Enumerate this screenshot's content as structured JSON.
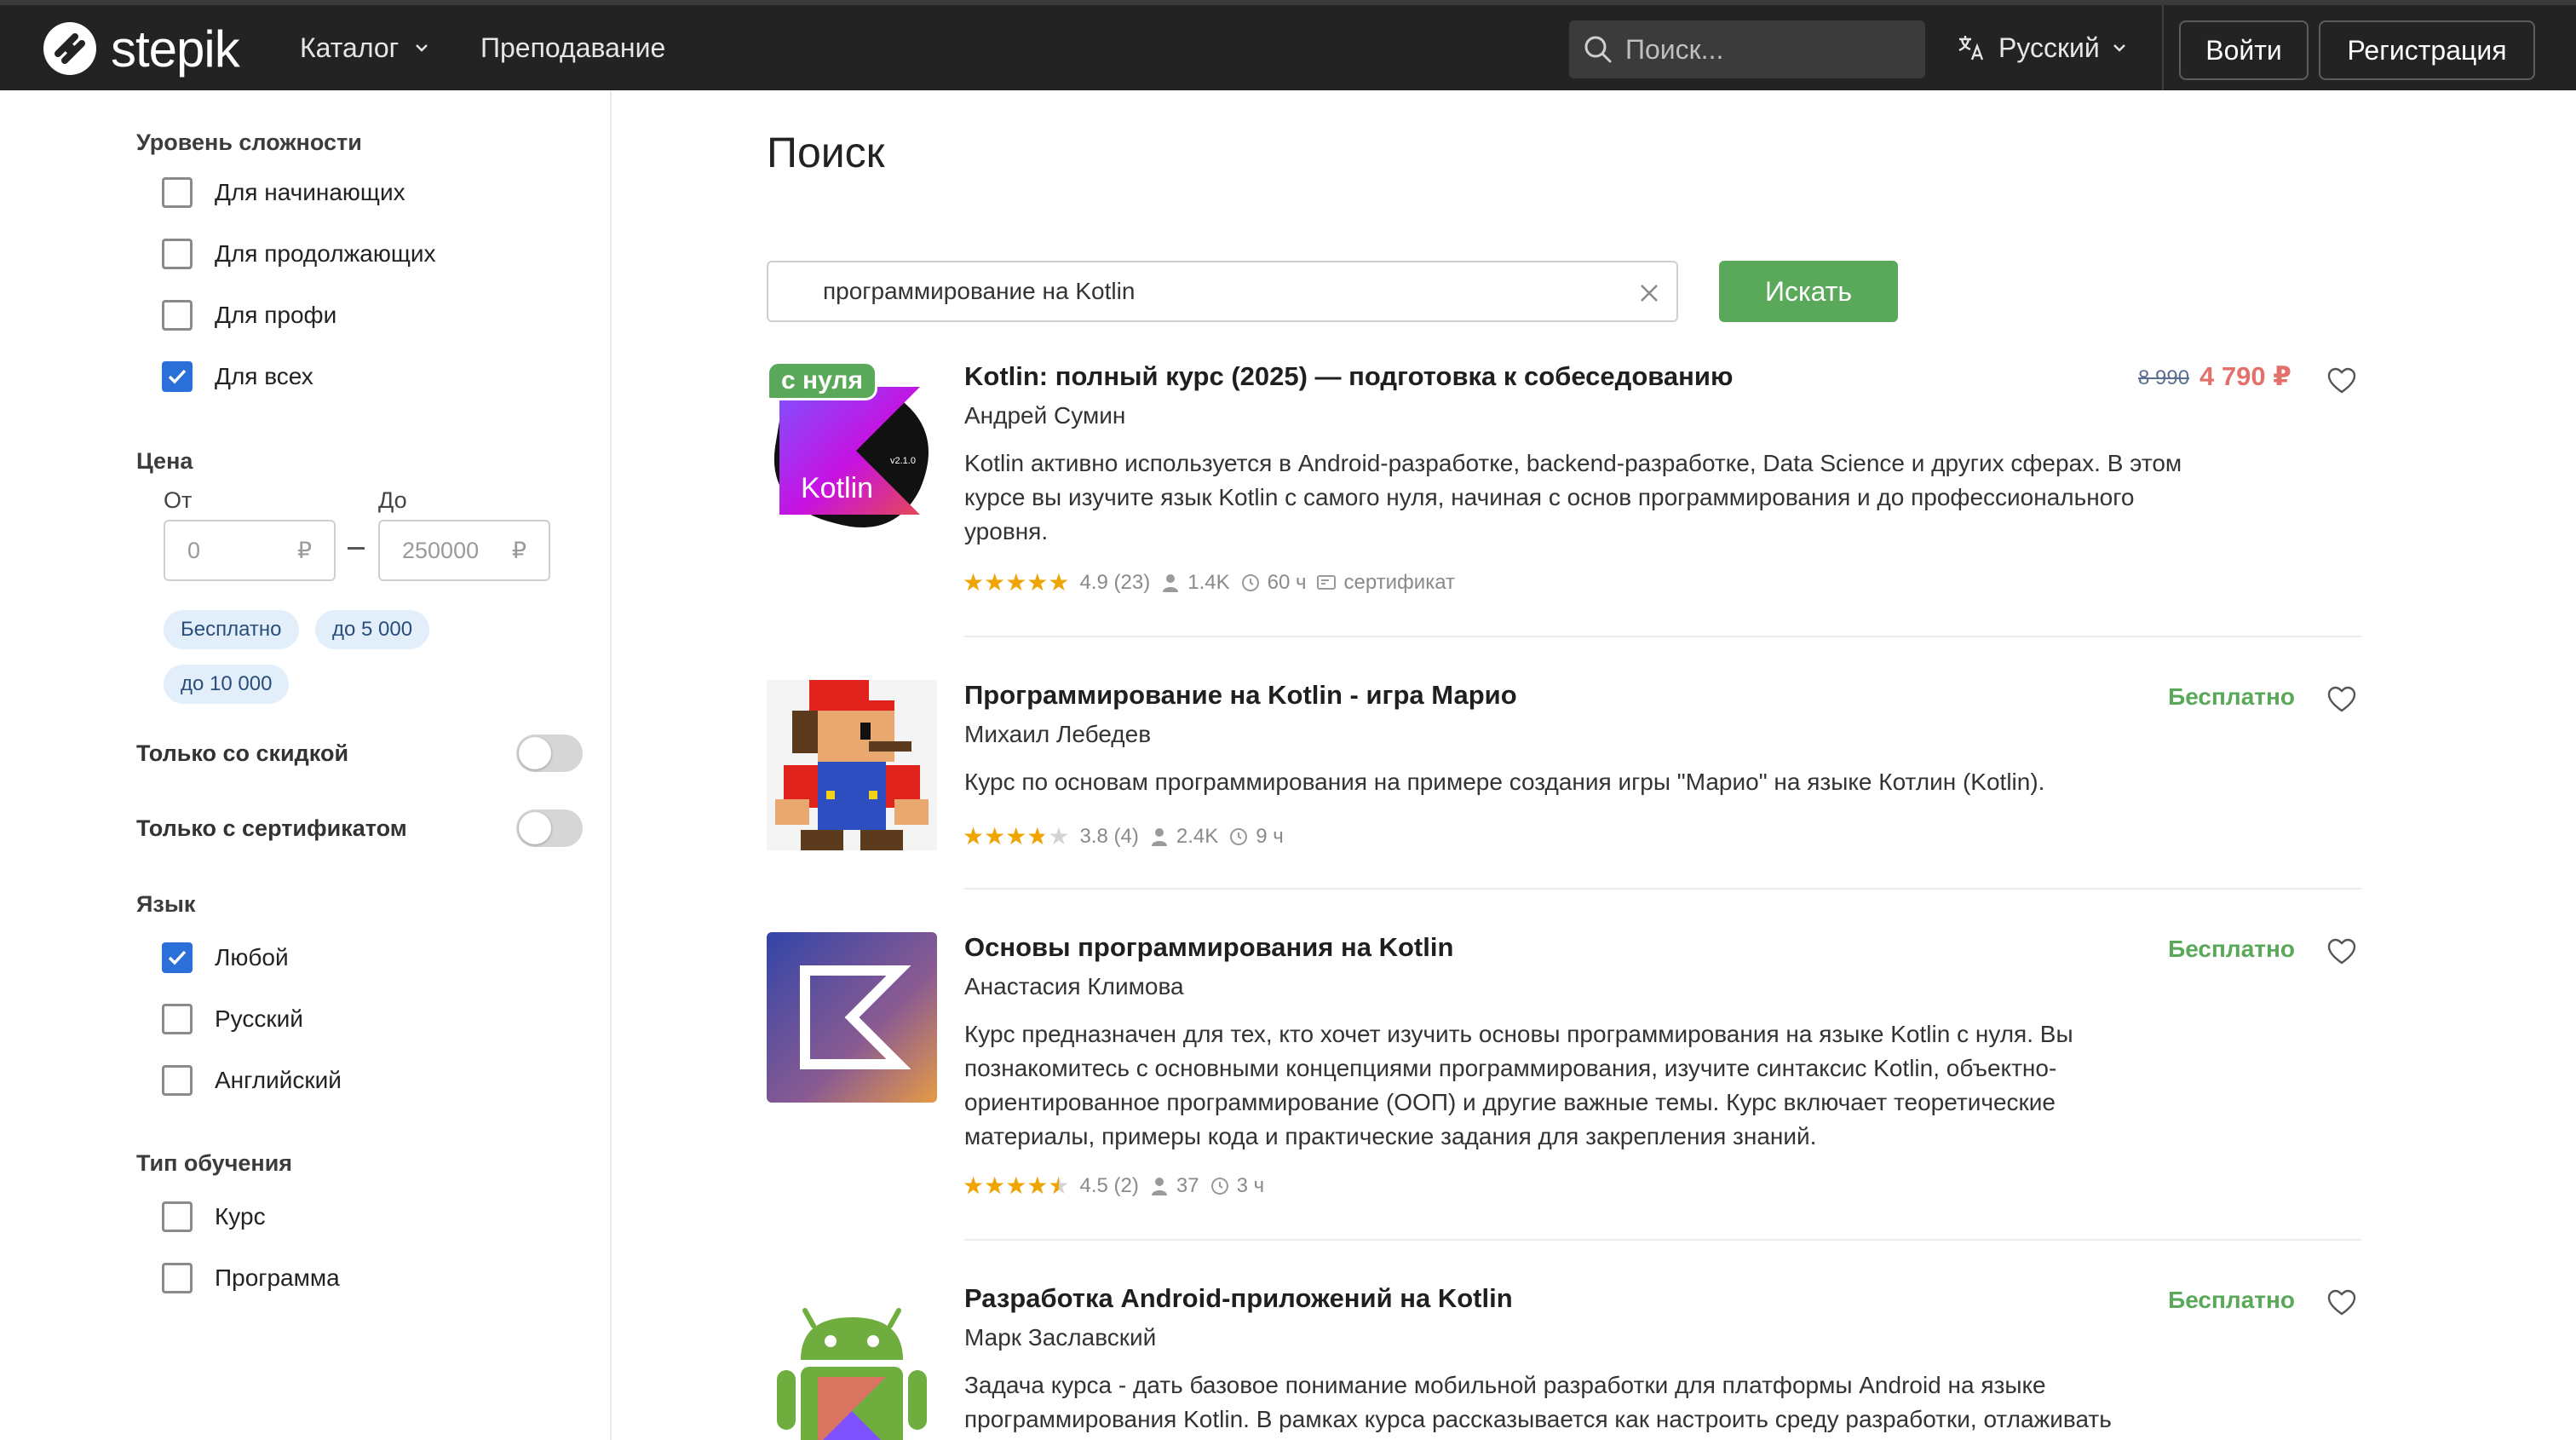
{
  "header": {
    "logo_text": "stepik",
    "nav_catalog": "Каталог",
    "nav_teaching": "Преподавание",
    "search_placeholder": "Поиск...",
    "language": "Русский",
    "login": "Войти",
    "register": "Регистрация"
  },
  "sidebar": {
    "difficulty": {
      "title": "Уровень сложности",
      "options": [
        {
          "label": "Для начинающих",
          "checked": false
        },
        {
          "label": "Для продолжающих",
          "checked": false
        },
        {
          "label": "Для профи",
          "checked": false
        },
        {
          "label": "Для всех",
          "checked": true
        }
      ]
    },
    "price": {
      "title": "Цена",
      "from_label": "От",
      "to_label": "До",
      "from_value": "0",
      "to_value": "250000",
      "currency": "₽",
      "chips": [
        "Бесплатно",
        "до 5 000",
        "до 10 000"
      ]
    },
    "toggles": [
      {
        "label": "Только со скидкой",
        "on": false
      },
      {
        "label": "Только с сертификатом",
        "on": false
      }
    ],
    "language": {
      "title": "Язык",
      "options": [
        {
          "label": "Любой",
          "checked": true
        },
        {
          "label": "Русский",
          "checked": false
        },
        {
          "label": "Английский",
          "checked": false
        }
      ]
    },
    "learning_type": {
      "title": "Тип обучения",
      "options": [
        {
          "label": "Курс",
          "checked": false
        },
        {
          "label": "Программа",
          "checked": false
        }
      ]
    }
  },
  "main": {
    "title": "Поиск",
    "query": "программирование на Kotlin",
    "search_button": "Искать",
    "courses": [
      {
        "title": "Kotlin: полный курс (2025) — подготовка к собеседованию",
        "author": "Андрей Сумин",
        "description": "Kotlin активно используется в Android-разработке, backend-разработке, Data Science и других сферах. В этом курсе вы изучите язык Kotlin с самого нуля, начиная с основ программирования и до профессионального уровня.",
        "rating": 4.9,
        "rating_text": "4.9 (23)",
        "learners": "1.4K",
        "hours": "60 ч",
        "certificate": "сертификат",
        "price_old": "8 990",
        "price_new": "4 790 ₽",
        "badge": "с нуля",
        "thumb_label": "Kotlin",
        "thumb_version": "v2.1.0"
      },
      {
        "title": "Программирование на Kotlin - игра Марио",
        "author": "Михаил Лебедев",
        "description": "Курс по основам программирования на примере создания игры \"Марио\" на языке Котлин (Kotlin).",
        "rating": 3.8,
        "rating_text": "3.8 (4)",
        "learners": "2.4K",
        "hours": "9 ч",
        "price": "Бесплатно"
      },
      {
        "title": "Основы программирования на Kotlin",
        "author": "Анастасия Климова",
        "description": "Курс предназначен для тех, кто хочет изучить основы программирования на языке Kotlin с нуля. Вы познакомитесь с основными концепциями программирования, изучите синтаксис Kotlin, объектно-ориентированное программирование (ООП) и другие важные темы. Курс включает теоретические материалы, примеры кода и практические задания для закрепления знаний.",
        "rating": 4.5,
        "rating_text": "4.5 (2)",
        "learners": "37",
        "hours": "3 ч",
        "price": "Бесплатно"
      },
      {
        "title": "Разработка Android-приложений на Kotlin",
        "author": "Марк Заславский",
        "description": "Задача курса - дать базовое понимание мобильной разработки для платформы Android на языке программирования Kotlin. В рамках курса рассказывается как настроить среду разработки, отлаживать",
        "price": "Бесплатно"
      }
    ]
  },
  "colors": {
    "header_bg": "#232323",
    "accent_green": "#5aa95a",
    "price_red": "#e4706b",
    "checkbox_blue": "#2b6fd9",
    "star": "#f0a400"
  }
}
